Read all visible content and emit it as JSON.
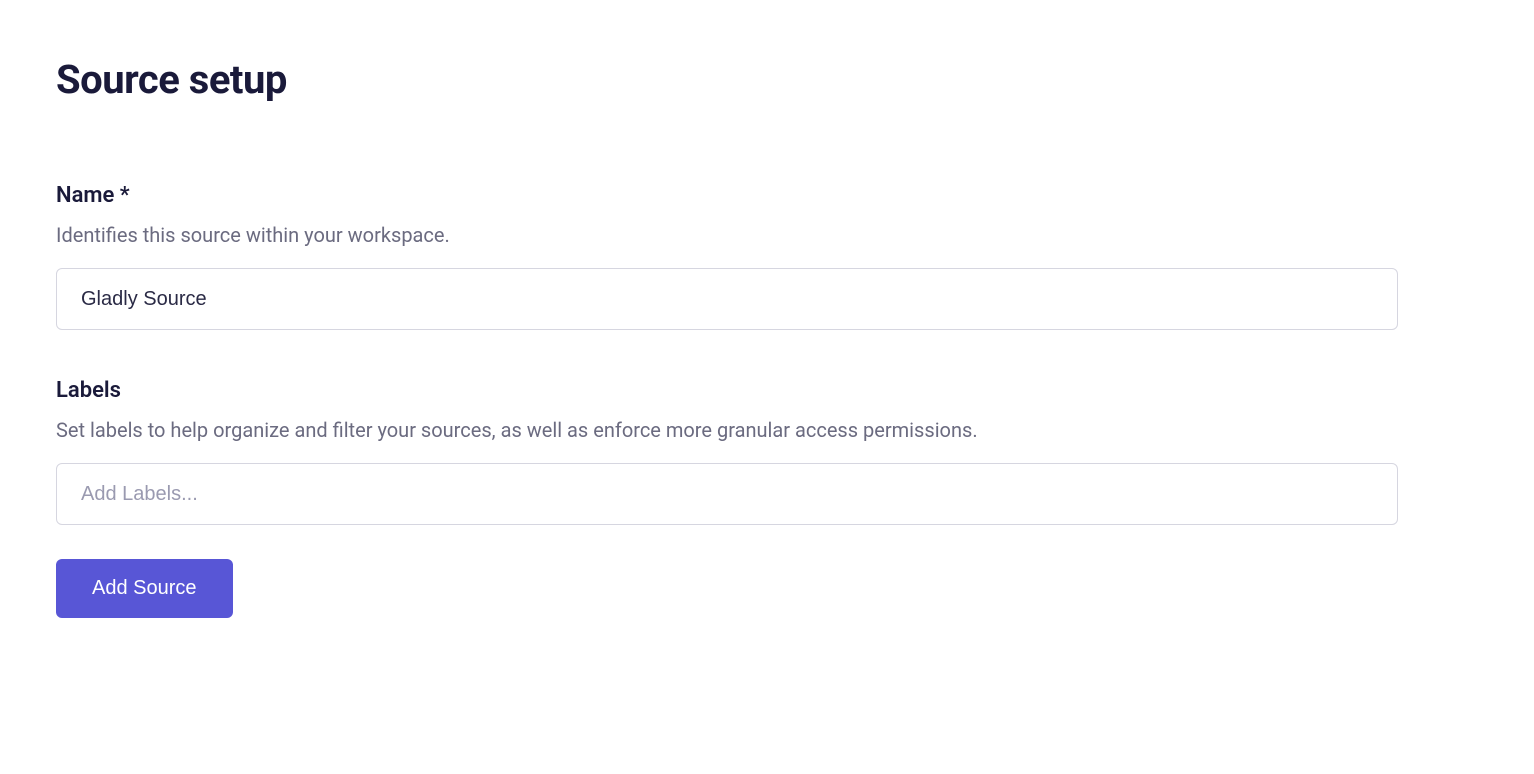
{
  "page": {
    "title": "Source setup"
  },
  "form": {
    "name": {
      "label": "Name *",
      "helper": "Identifies this source within your workspace.",
      "value": "Gladly Source"
    },
    "labels": {
      "label": "Labels",
      "helper": "Set labels to help organize and filter your sources, as well as enforce more granular access permissions.",
      "placeholder": "Add Labels..."
    },
    "submit": {
      "label": "Add Source"
    }
  }
}
